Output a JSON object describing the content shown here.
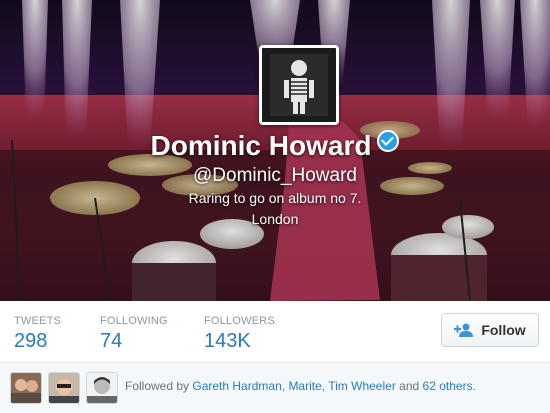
{
  "profile": {
    "name": "Dominic Howard",
    "handle": "@Dominic_Howard",
    "bio": "Raring to go on album no 7.",
    "location": "London"
  },
  "stats": [
    {
      "label": "TWEETS",
      "value": "298"
    },
    {
      "label": "FOLLOWING",
      "value": "74"
    },
    {
      "label": "FOLLOWERS",
      "value": "143K"
    }
  ],
  "follow_button": {
    "label": "Follow"
  },
  "followed_by": {
    "prefix": "Followed by",
    "names": [
      "Gareth Hardman",
      "Marite",
      "Tim Wheeler"
    ],
    "sep1": ",",
    "sep2": ",",
    "and": "and",
    "others": "62 others",
    "suffix": "."
  },
  "colors": {
    "link": "#2b7bb9",
    "verified": "#2b9ee8",
    "stat_label": "#8899a6"
  },
  "icons": {
    "verified": "verified-badge-icon",
    "follow": "add-user-icon"
  }
}
